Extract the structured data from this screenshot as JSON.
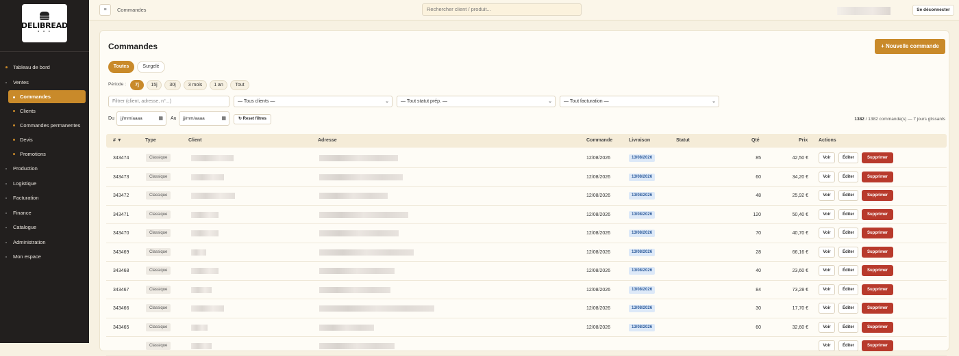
{
  "brand": {
    "name": "DELIBREAD",
    "dots": "• • •"
  },
  "sidebar": {
    "items": [
      {
        "label": "Tableau de bord",
        "kind": "item"
      },
      {
        "label": "Ventes",
        "kind": "item-mute"
      },
      {
        "label": "Commandes",
        "kind": "sub-active"
      },
      {
        "label": "Clients",
        "kind": "sub"
      },
      {
        "label": "Commandes permanentes",
        "kind": "sub"
      },
      {
        "label": "Devis",
        "kind": "sub"
      },
      {
        "label": "Promotions",
        "kind": "sub"
      },
      {
        "label": "Production",
        "kind": "item-mute"
      },
      {
        "label": "Logistique",
        "kind": "item-mute"
      },
      {
        "label": "Facturation",
        "kind": "item-mute"
      },
      {
        "label": "Finance",
        "kind": "item-mute"
      },
      {
        "label": "Catalogue",
        "kind": "item-mute"
      },
      {
        "label": "Administration",
        "kind": "item-mute"
      },
      {
        "label": "Mon espace",
        "kind": "item-mute"
      }
    ]
  },
  "topbar": {
    "menu_icon": "≡",
    "breadcrumb": "Commandes",
    "search_placeholder": "Rechercher client / produit...",
    "logout": "Se déconnecter"
  },
  "page": {
    "title": "Commandes",
    "new_button": "+ Nouvelle commande"
  },
  "tabs": [
    "Toutes",
    "Surgelé"
  ],
  "periode": {
    "label": "Période :",
    "options": [
      "7j",
      "15j",
      "30j",
      "3 mois",
      "1 an",
      "Tout"
    ],
    "active": "7j"
  },
  "filters": {
    "text_placeholder": "Filtrer (client, adresse, n°...)",
    "clients": "— Tous clients —",
    "statut": "— Tout statut prép. —",
    "facturation": "— Tout facturation —",
    "du_label": "Du",
    "au_label": "Au",
    "date_placeholder": "jj/mm/aaaa",
    "reset": "↻ Reset filtres"
  },
  "count": {
    "shown": "1382",
    "rest": " / 1382 commande(s) — 7 jours glissants"
  },
  "table": {
    "headers": {
      "num": "# ▼",
      "type": "Type",
      "client": "Client",
      "adresse": "Adresse",
      "commande": "Commande",
      "livraison": "Livraison",
      "statut": "Statut",
      "qte": "Qté",
      "prix": "Prix",
      "actions": "Actions"
    },
    "action_labels": {
      "voir": "Voir",
      "editer": "Éditer",
      "supprimer": "Supprimer"
    },
    "rows": [
      {
        "id": "343474",
        "type": "Classique",
        "commande": "12/08/2026",
        "livraison": "13/08/2026",
        "qte": "85",
        "prix": "42,50 €"
      },
      {
        "id": "343473",
        "type": "Classique",
        "commande": "12/08/2026",
        "livraison": "13/08/2026",
        "qte": "60",
        "prix": "34,20 €"
      },
      {
        "id": "343472",
        "type": "Classique",
        "commande": "12/08/2026",
        "livraison": "13/08/2026",
        "qte": "48",
        "prix": "25,92 €"
      },
      {
        "id": "343471",
        "type": "Classique",
        "commande": "12/08/2026",
        "livraison": "13/08/2026",
        "qte": "120",
        "prix": "50,40 €"
      },
      {
        "id": "343470",
        "type": "Classique",
        "commande": "12/08/2026",
        "livraison": "13/08/2026",
        "qte": "70",
        "prix": "40,70 €"
      },
      {
        "id": "343469",
        "type": "Classique",
        "commande": "12/08/2026",
        "livraison": "13/08/2026",
        "qte": "28",
        "prix": "66,16 €"
      },
      {
        "id": "343468",
        "type": "Classique",
        "commande": "12/08/2026",
        "livraison": "13/08/2026",
        "qte": "40",
        "prix": "23,60 €"
      },
      {
        "id": "343467",
        "type": "Classique",
        "commande": "12/08/2026",
        "livraison": "13/08/2026",
        "qte": "84",
        "prix": "73,28 €"
      },
      {
        "id": "343466",
        "type": "Classique",
        "commande": "12/08/2026",
        "livraison": "13/08/2026",
        "qte": "30",
        "prix": "17,70 €"
      },
      {
        "id": "343465",
        "type": "Classique",
        "commande": "12/08/2026",
        "livraison": "13/08/2026",
        "qte": "60",
        "prix": "32,60 €"
      },
      {
        "id": "",
        "type": "Classique",
        "commande": "",
        "livraison": "",
        "qte": "",
        "prix": ""
      }
    ]
  },
  "colors": {
    "accent": "#c98a2a",
    "danger": "#b83a2c",
    "sidebar": "#221f1e"
  }
}
